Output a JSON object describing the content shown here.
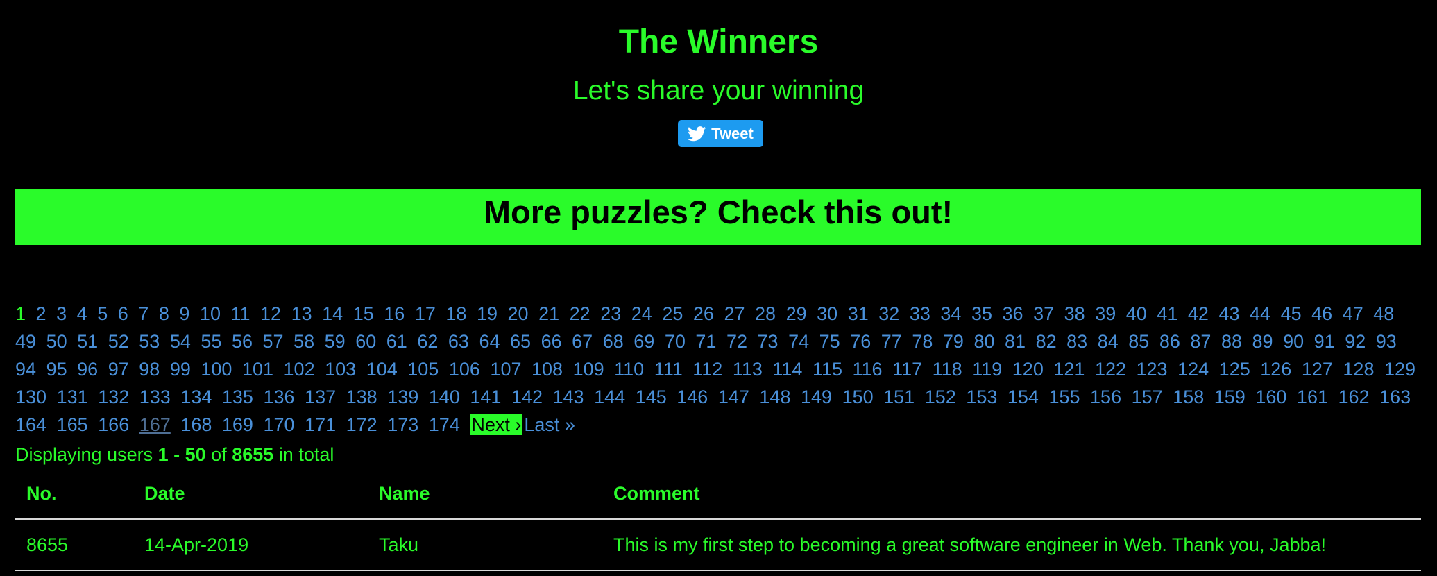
{
  "header": {
    "title": "The Winners",
    "subtitle": "Let's share your winning",
    "tweet_label": "Tweet",
    "tweet_icon": "twitter-bird-icon"
  },
  "banner": {
    "text": "More puzzles? Check this out!"
  },
  "pagination": {
    "current_page": 1,
    "visited_page": 167,
    "first_page": 1,
    "last_page_number": 174,
    "next_label": "Next ›",
    "last_label": "Last »"
  },
  "summary": {
    "prefix": "Displaying users",
    "range": "1 - 50",
    "of": "of",
    "total": "8655",
    "suffix": "in total"
  },
  "table": {
    "headers": [
      "No.",
      "Date",
      "Name",
      "Comment"
    ],
    "rows": [
      {
        "no": "8655",
        "date": "14-Apr-2019",
        "name": "Taku",
        "comment": "This is my first step to becoming a great software engineer in Web. Thank you, Jabba!"
      }
    ]
  },
  "colors": {
    "accent_green": "#2afb2a",
    "link_blue": "#4a90d9",
    "tweet_blue": "#1d9bf0",
    "background": "#000000"
  }
}
